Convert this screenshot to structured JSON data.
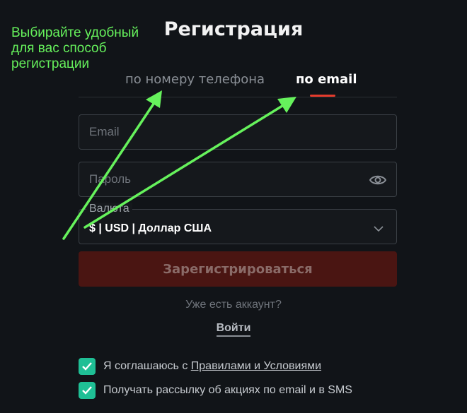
{
  "page": {
    "title": "Регистрация"
  },
  "annotation": {
    "text": "Выбирайте удобный для вас способ регистрации",
    "color": "#66f25c"
  },
  "tabs": [
    {
      "label": "по номеру телефона",
      "active": false
    },
    {
      "label": "по email",
      "active": true
    }
  ],
  "form": {
    "email_placeholder": "Email",
    "password_placeholder": "Пароль",
    "currency_label": "Валюта",
    "currency_value": "$ | USD | Доллар США",
    "submit_label": "Зарегистрироваться"
  },
  "login": {
    "prompt": "Уже есть аккаунт?",
    "link_label": "Войти"
  },
  "consents": [
    {
      "prefix": "Я соглашаюсь с ",
      "link": "Правилами и Условиями",
      "checked": true
    },
    {
      "text": "Получать рассылку об акциях по email и в SMS",
      "checked": true
    }
  ],
  "colors": {
    "accent": "#e53b2c",
    "checkbox": "#1fbf95",
    "background": "#111418"
  },
  "icons": {
    "password_toggle": "eye-icon",
    "currency_dropdown": "chevron-down-icon",
    "checkbox": "check-icon"
  }
}
